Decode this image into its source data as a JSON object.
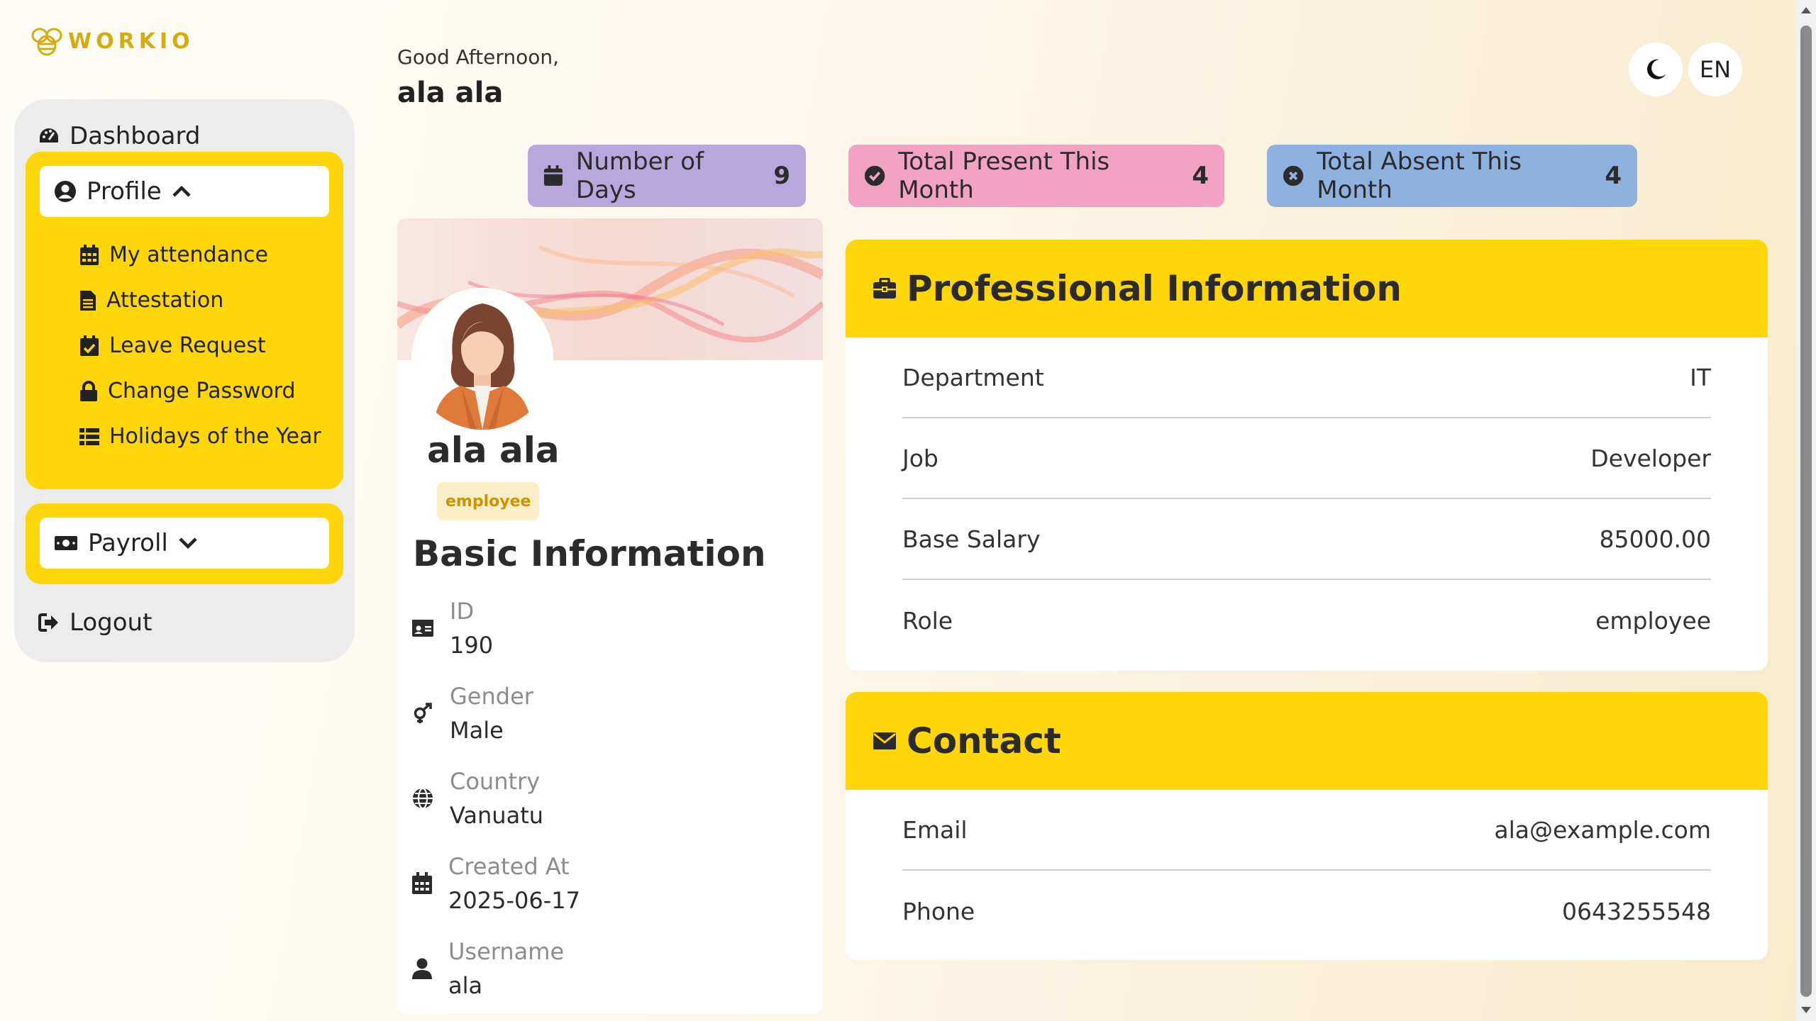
{
  "app": {
    "logo_text": "WORKIO"
  },
  "sidebar": {
    "dashboard": "Dashboard",
    "profile": "Profile",
    "profile_items": [
      {
        "label": "My attendance",
        "icon": "calendar-icon"
      },
      {
        "label": "Attestation",
        "icon": "file-icon"
      },
      {
        "label": "Leave Request",
        "icon": "calendar-check-icon"
      },
      {
        "label": "Change Password",
        "icon": "lock-icon"
      },
      {
        "label": "Holidays of the Year",
        "icon": "list-icon"
      }
    ],
    "payroll": "Payroll",
    "logout": "Logout"
  },
  "header": {
    "greeting": "Good Afternoon,",
    "user": "ala ala",
    "lang": "EN",
    "theme_icon": "moon-icon"
  },
  "stats": [
    {
      "label": "Number of Days",
      "value": "9",
      "color": "#b7a7dd",
      "icon": "calendar-icon"
    },
    {
      "label": "Total Present This Month",
      "value": "4",
      "color": "#f2a2c2",
      "icon": "check-circle-icon"
    },
    {
      "label": "Total Absent This Month",
      "value": "4",
      "color": "#8fb1e0",
      "icon": "x-circle-icon"
    }
  ],
  "profile_card": {
    "name": "ala ala",
    "badge": "employee",
    "basic_title": "Basic Information",
    "fields": [
      {
        "label": "ID",
        "value": "190",
        "icon": "id-card-icon"
      },
      {
        "label": "Gender",
        "value": "Male",
        "icon": "gender-icon"
      },
      {
        "label": "Country",
        "value": "Vanuatu",
        "icon": "globe-icon"
      },
      {
        "label": "Created At",
        "value": "2025-06-17",
        "icon": "calendar-icon"
      },
      {
        "label": "Username",
        "value": "ala",
        "icon": "user-icon"
      }
    ]
  },
  "professional": {
    "title": "Professional Information",
    "rows": [
      {
        "label": "Department",
        "value": "IT"
      },
      {
        "label": "Job",
        "value": "Developer"
      },
      {
        "label": "Base Salary",
        "value": "85000.00"
      },
      {
        "label": "Role",
        "value": "employee"
      }
    ]
  },
  "contact": {
    "title": "Contact",
    "rows": [
      {
        "label": "Email",
        "value": "ala@example.com"
      },
      {
        "label": "Phone",
        "value": "0643255548"
      }
    ]
  },
  "colors": {
    "accent": "#ffd60a",
    "badge_bg": "#fcefc8",
    "badge_text": "#c99400"
  }
}
